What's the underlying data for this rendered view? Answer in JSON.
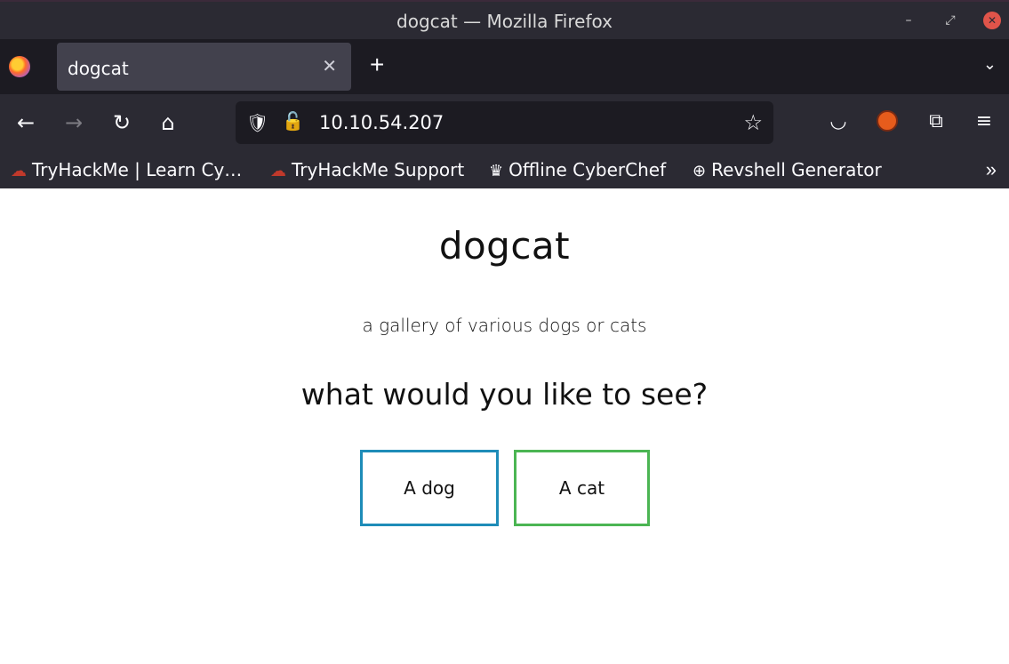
{
  "window": {
    "title": "dogcat — Mozilla Firefox"
  },
  "tabs": [
    {
      "label": "dogcat"
    }
  ],
  "urlbar": {
    "url": "10.10.54.207"
  },
  "bookmarks": [
    {
      "label": "TryHackMe | Learn Cy…",
      "icon": "cloud-icon"
    },
    {
      "label": "TryHackMe Support",
      "icon": "cloud-icon"
    },
    {
      "label": "Offline CyberChef",
      "icon": "chef-hat-icon"
    },
    {
      "label": "Revshell Generator",
      "icon": "globe-icon"
    }
  ],
  "page": {
    "title": "dogcat",
    "subtitle": "a gallery of various dogs or cats",
    "question": "what would you like to see?",
    "buttons": {
      "dog": "A dog",
      "cat": "A cat"
    }
  },
  "colors": {
    "dog_border": "#1e8cb8",
    "cat_border": "#4bb553",
    "chrome_bg": "#2b2a33",
    "tab_bg": "#42414d"
  }
}
